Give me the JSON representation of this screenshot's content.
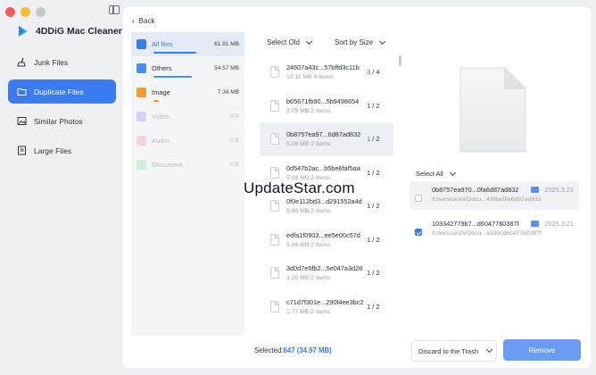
{
  "app": {
    "name": "4DDiG Mac Cleaner"
  },
  "sidebar": {
    "items": [
      {
        "label": "Junk Files",
        "icon": "broom-icon",
        "active": false
      },
      {
        "label": "Duplicate Files",
        "icon": "folder-icon",
        "active": true
      },
      {
        "label": "Similar Photos",
        "icon": "photo-icon",
        "active": false
      },
      {
        "label": "Large Files",
        "icon": "large-file-icon",
        "active": false
      }
    ]
  },
  "main": {
    "back_label": "Back"
  },
  "categories": [
    {
      "label": "All files",
      "size": "61.91  MB",
      "color": "#3b7bf0",
      "fill": 0.9,
      "disabled": false,
      "active": true
    },
    {
      "label": "Others",
      "size": "54.57  MB",
      "color": "#4a8df0",
      "fill": 0.8,
      "disabled": false,
      "active": false
    },
    {
      "label": "Image",
      "size": "7.34  MB",
      "color": "#f59a2e",
      "fill": 0.15,
      "disabled": false,
      "active": false
    },
    {
      "label": "Video",
      "size": "0  B",
      "color": "#b3a8f0",
      "fill": 0,
      "disabled": true,
      "active": false
    },
    {
      "label": "Audio",
      "size": "0  B",
      "color": "#f2a8b3",
      "fill": 0,
      "disabled": true,
      "active": false
    },
    {
      "label": "Document",
      "size": "0  B",
      "color": "#a8e0c0",
      "fill": 0,
      "disabled": true,
      "active": false
    }
  ],
  "list_header": {
    "sort_primary": "Select Old",
    "sort_secondary": "Sort by Size"
  },
  "files": [
    {
      "name": "24607a43c...57bffd3c11b",
      "meta": "10.11  MB  4 Items",
      "count_cur": "3",
      "count_total": " / 4",
      "active": false
    },
    {
      "name": "b65671fb90...5b9498654",
      "meta": "9.75  MB  2 Items",
      "count_cur": "",
      "count_total": "1 / 2",
      "active": false
    },
    {
      "name": "0b8757ea97...6d87ad832",
      "meta": "5.06  MB  2 Items",
      "count_cur": "1",
      "count_total": " / 2",
      "active": true
    },
    {
      "name": "0d547b2ac...b5be6faf5aa",
      "meta": "5.06  MB  2 Items",
      "count_cur": "",
      "count_total": "1 / 2",
      "active": false
    },
    {
      "name": "0f0e112bd3...d291552a4d",
      "meta": "5.06  MB  2 Items",
      "count_cur": "",
      "count_total": "1 / 2",
      "active": false
    },
    {
      "name": "edfa1f0903...ee5e00c57d",
      "meta": "5.06  MB  2 Items",
      "count_cur": "",
      "count_total": "1 / 2",
      "active": false
    },
    {
      "name": "3d0d7e5fb2...5e047a3d28",
      "meta": "3.28  MB  2 Items",
      "count_cur": "",
      "count_total": "1 / 2",
      "active": false
    },
    {
      "name": "c71d7f301e...290f4ee3bc2",
      "meta": "1.77  MB  2 Items",
      "count_cur": "",
      "count_total": "1 / 2",
      "active": false
    }
  ],
  "preview": {
    "select_all_label": "Select All",
    "duplicates": [
      {
        "name": "0b8757ea970...0fa6d87ad832",
        "date": "2025.3.21",
        "path": "/Users/ceshi/Docu...436bc0fa6d87ad832",
        "checked": false,
        "highlight": true
      },
      {
        "name": "103342779b7...d6047780387f",
        "date": "2025.3.21",
        "path": "/Users/ceshi/Docu...ad39cd6047780387f",
        "checked": true,
        "highlight": false
      }
    ]
  },
  "footer": {
    "selected_label": "Selected:",
    "selected_value": "647 (34.97  MB)",
    "discard_label": "Discard to the Trash",
    "remove_label": "Remove"
  },
  "watermark": "UpdateStar.com",
  "colors": {
    "accent": "#3b7bf0",
    "remove_button": "#6b9cf3"
  }
}
